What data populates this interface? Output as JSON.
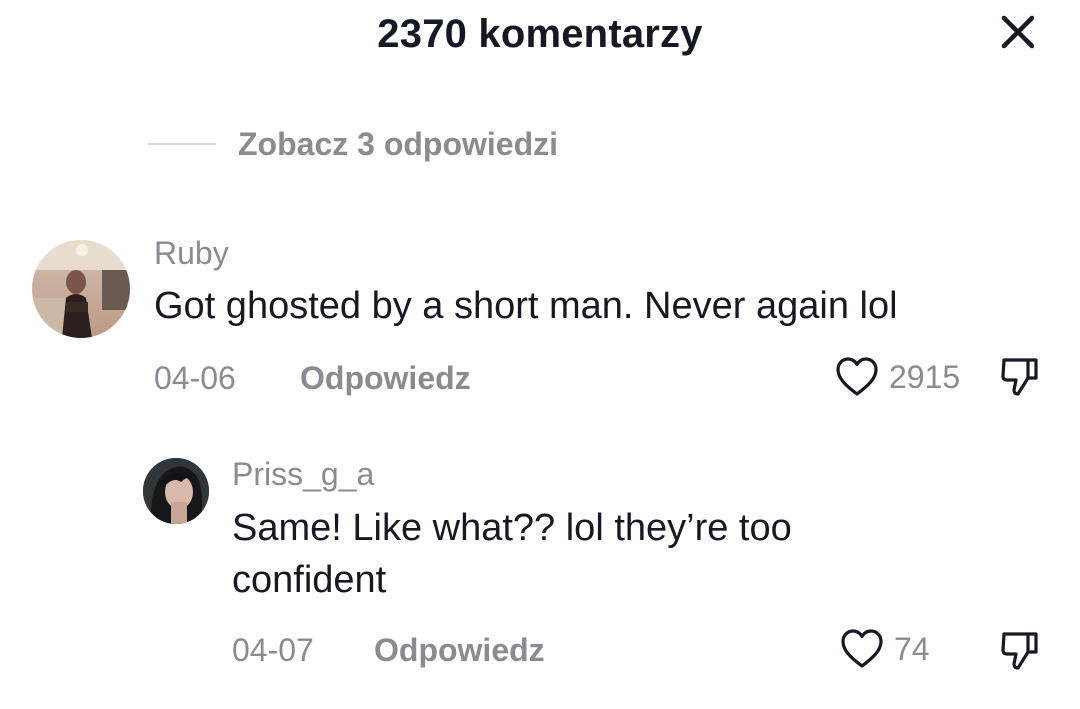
{
  "header": {
    "title": "2370 komentarzy"
  },
  "view_replies": {
    "label": "Zobacz 3 odpowiedzi"
  },
  "comments": [
    {
      "username": "Ruby",
      "text": "Got ghosted by a short man. Never again lol",
      "date": "04-06",
      "reply_label": "Odpowiedz",
      "likes": "2915"
    },
    {
      "username": "Priss_g_a",
      "text": "Same! Like what?? lol they’re too confident",
      "date": "04-07",
      "reply_label": "Odpowiedz",
      "likes": "74"
    }
  ],
  "icons": {
    "close": "close-icon",
    "like": "heart-outline-icon",
    "dislike": "thumbs-down-icon"
  },
  "colors": {
    "text_primary": "#161823",
    "text_secondary": "#8a8b91",
    "divider": "#d8d8da",
    "background": "#ffffff"
  }
}
